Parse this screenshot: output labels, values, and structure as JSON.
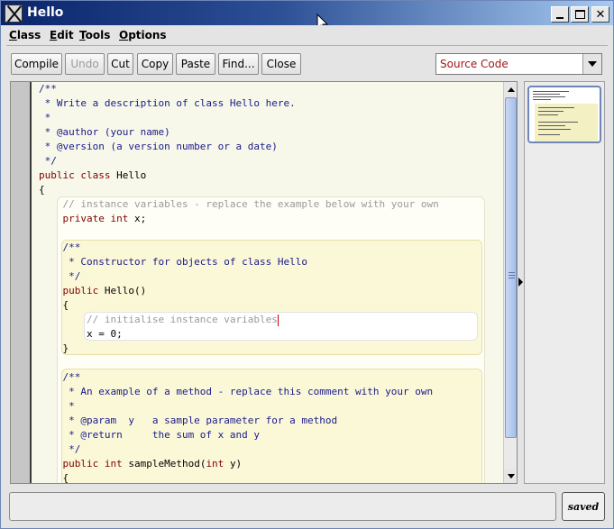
{
  "window": {
    "title": "Hello"
  },
  "menu": [
    "Class",
    "Edit",
    "Tools",
    "Options"
  ],
  "toolbar": {
    "compile": "Compile",
    "undo": "Undo",
    "cut": "Cut",
    "copy": "Copy",
    "paste": "Paste",
    "find": "Find...",
    "close": "Close"
  },
  "view_selector": {
    "value": "Source Code"
  },
  "code": [
    [
      {
        "t": "/**",
        "c": "cm"
      }
    ],
    [
      {
        "t": " * Write a description of class Hello here.",
        "c": "cm"
      }
    ],
    [
      {
        "t": " *",
        "c": "cm"
      }
    ],
    [
      {
        "t": " * @author (your name)",
        "c": "cm"
      }
    ],
    [
      {
        "t": " * @version (a version number or a date)",
        "c": "cm"
      }
    ],
    [
      {
        "t": " */",
        "c": "cm"
      }
    ],
    [
      {
        "t": "public class ",
        "c": "kw"
      },
      {
        "t": "Hello",
        "c": "tx"
      }
    ],
    [
      {
        "t": "{",
        "c": "tx"
      }
    ],
    [
      {
        "t": "    // instance variables - replace the example below with your own",
        "c": "cm-light"
      }
    ],
    [
      {
        "t": "    private int ",
        "c": "kw"
      },
      {
        "t": "x;",
        "c": "tx"
      }
    ],
    [
      {
        "t": "",
        "c": "tx"
      }
    ],
    [
      {
        "t": "    /**",
        "c": "cm"
      }
    ],
    [
      {
        "t": "     * Constructor for objects of class Hello",
        "c": "cm"
      }
    ],
    [
      {
        "t": "     */",
        "c": "cm"
      }
    ],
    [
      {
        "t": "    public ",
        "c": "kw"
      },
      {
        "t": "Hello()",
        "c": "tx"
      }
    ],
    [
      {
        "t": "    {",
        "c": "tx"
      }
    ],
    [
      {
        "t": "        // initialise instance variables",
        "c": "cm-light",
        "caret": true
      }
    ],
    [
      {
        "t": "        x = 0;",
        "c": "tx"
      }
    ],
    [
      {
        "t": "    }",
        "c": "tx"
      }
    ],
    [
      {
        "t": "",
        "c": "tx"
      }
    ],
    [
      {
        "t": "    /**",
        "c": "cm"
      }
    ],
    [
      {
        "t": "     * An example of a method - replace this comment with your own",
        "c": "cm"
      }
    ],
    [
      {
        "t": "     *",
        "c": "cm"
      }
    ],
    [
      {
        "t": "     * @param  y   a sample parameter for a method",
        "c": "cm"
      }
    ],
    [
      {
        "t": "     * @return     the sum of x and y",
        "c": "cm"
      }
    ],
    [
      {
        "t": "     */",
        "c": "cm"
      }
    ],
    [
      {
        "t": "    public int ",
        "c": "kw"
      },
      {
        "t": "sampleMethod(",
        "c": "tx"
      },
      {
        "t": "int ",
        "c": "kw"
      },
      {
        "t": "y)",
        "c": "tx"
      }
    ],
    [
      {
        "t": "    {",
        "c": "tx"
      }
    ]
  ],
  "status": {
    "message": "",
    "saved_label": "saved"
  },
  "colors": {
    "keyword": "#800000",
    "comment": "#1a1a8a",
    "selector_text": "#a01818"
  },
  "icons": [
    "bluej-app-icon",
    "minimize-icon",
    "maximize-icon",
    "close-icon",
    "chevron-down-icon",
    "scroll-up-icon",
    "scroll-down-icon",
    "expand-panel-icon",
    "mouse-cursor-icon"
  ]
}
